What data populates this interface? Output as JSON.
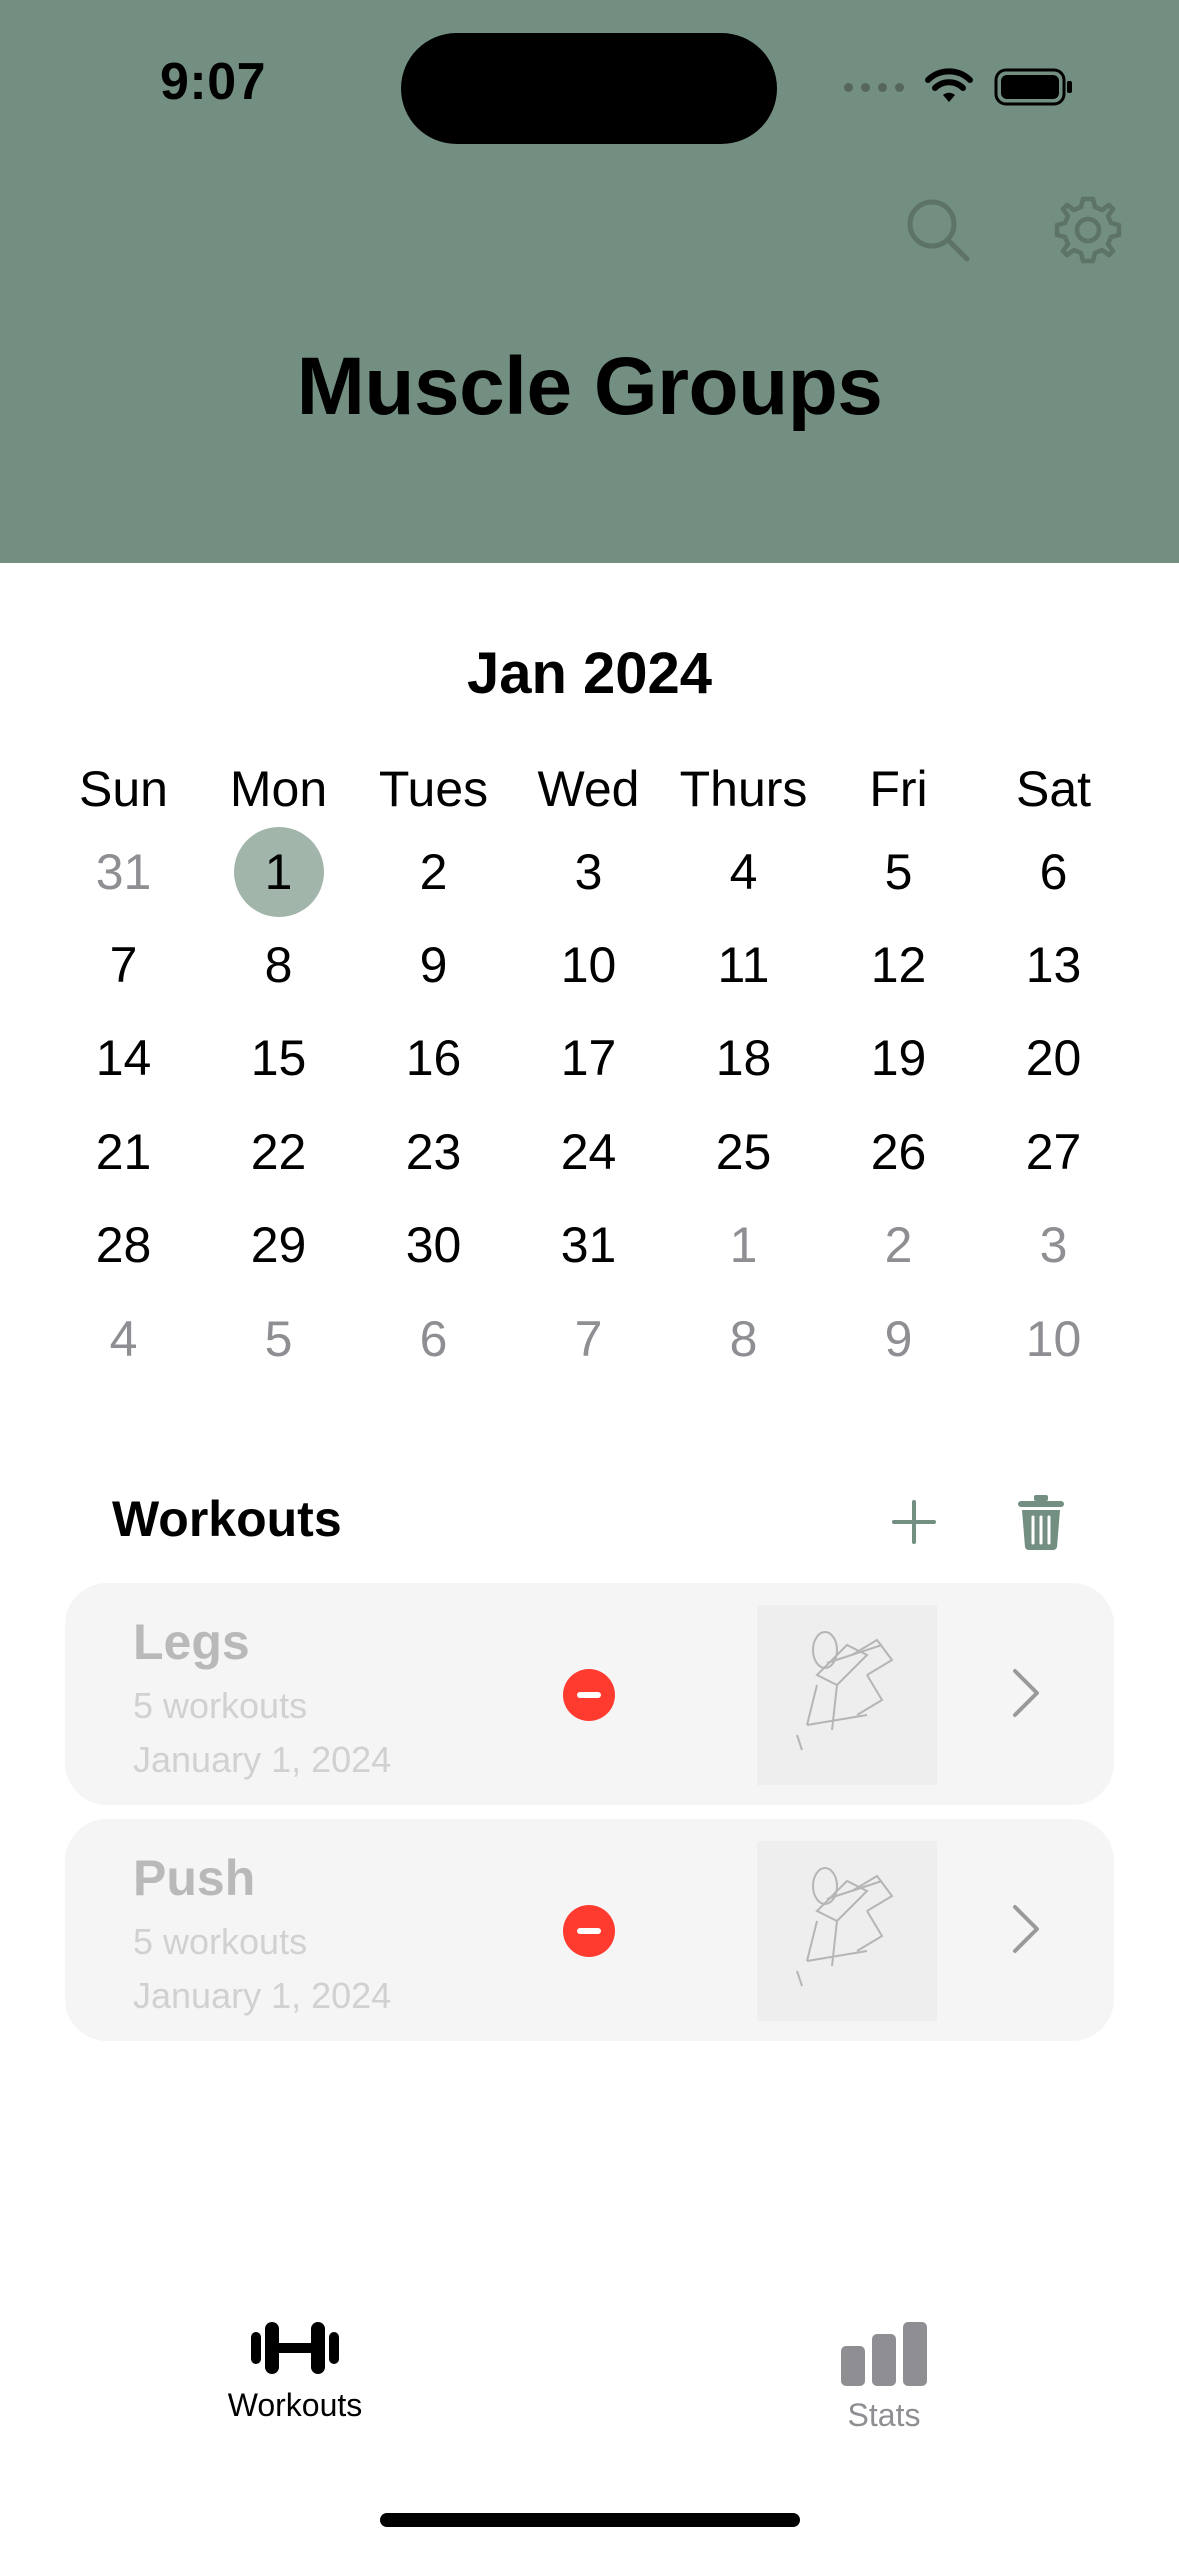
{
  "status_bar": {
    "time": "9:07"
  },
  "header": {
    "title": "Muscle Groups",
    "background": "#738f81",
    "search_icon": "search-icon",
    "settings_icon": "gear-icon"
  },
  "calendar": {
    "month_label": "Jan 2024",
    "weekdays": [
      "Sun",
      "Mon",
      "Tues",
      "Wed",
      "Thurs",
      "Fri",
      "Sat"
    ],
    "selected_color": "#a1b5aa",
    "weeks": [
      [
        {
          "d": "31",
          "m": true
        },
        {
          "d": "1",
          "s": true
        },
        {
          "d": "2"
        },
        {
          "d": "3"
        },
        {
          "d": "4"
        },
        {
          "d": "5"
        },
        {
          "d": "6"
        }
      ],
      [
        {
          "d": "7"
        },
        {
          "d": "8"
        },
        {
          "d": "9"
        },
        {
          "d": "10"
        },
        {
          "d": "11"
        },
        {
          "d": "12"
        },
        {
          "d": "13"
        }
      ],
      [
        {
          "d": "14"
        },
        {
          "d": "15"
        },
        {
          "d": "16"
        },
        {
          "d": "17"
        },
        {
          "d": "18"
        },
        {
          "d": "19"
        },
        {
          "d": "20"
        }
      ],
      [
        {
          "d": "21"
        },
        {
          "d": "22"
        },
        {
          "d": "23"
        },
        {
          "d": "24"
        },
        {
          "d": "25"
        },
        {
          "d": "26"
        },
        {
          "d": "27"
        }
      ],
      [
        {
          "d": "28"
        },
        {
          "d": "29"
        },
        {
          "d": "30"
        },
        {
          "d": "31"
        },
        {
          "d": "1",
          "m": true
        },
        {
          "d": "2",
          "m": true
        },
        {
          "d": "3",
          "m": true
        }
      ],
      [
        {
          "d": "4",
          "m": true
        },
        {
          "d": "5",
          "m": true
        },
        {
          "d": "6",
          "m": true
        },
        {
          "d": "7",
          "m": true
        },
        {
          "d": "8",
          "m": true
        },
        {
          "d": "9",
          "m": true
        },
        {
          "d": "10",
          "m": true
        }
      ]
    ]
  },
  "workouts": {
    "title": "Workouts",
    "add_icon": "plus-icon",
    "delete_icon": "trash-icon",
    "accent": "#738f81",
    "items": [
      {
        "name": "Legs",
        "count": "5 workouts",
        "date": "January 1, 2024"
      },
      {
        "name": "Push",
        "count": "5 workouts",
        "date": "January 1, 2024"
      }
    ]
  },
  "tab_bar": {
    "tabs": [
      {
        "label": "Workouts",
        "icon": "dumbbell-icon",
        "active": true
      },
      {
        "label": "Stats",
        "icon": "bar-chart-icon",
        "active": false
      }
    ]
  }
}
